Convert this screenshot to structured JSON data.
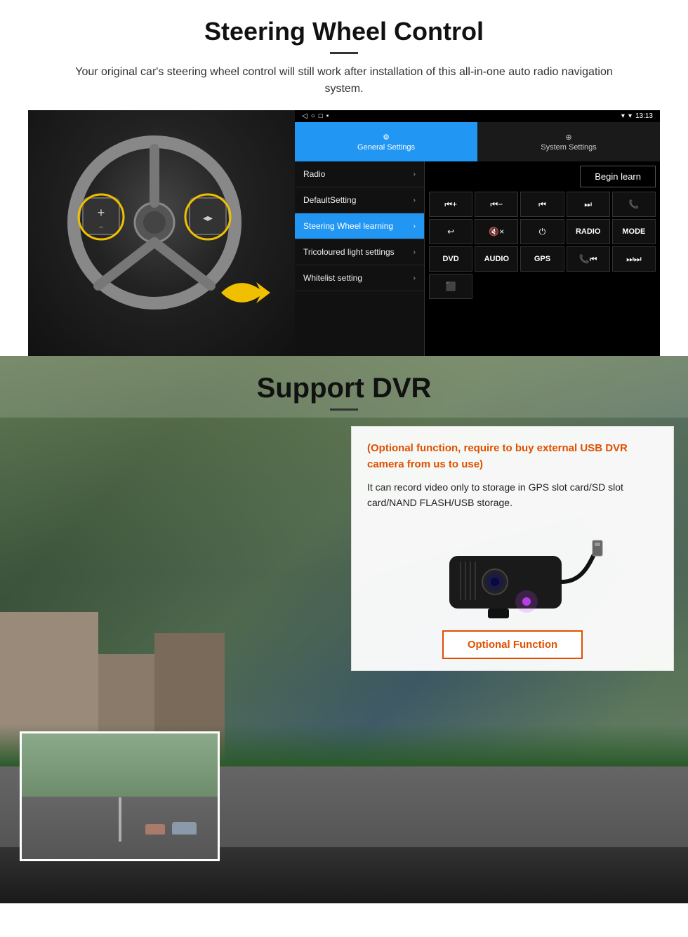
{
  "steering_section": {
    "title": "Steering Wheel Control",
    "subtitle": "Your original car's steering wheel control will still work after installation of this all-in-one auto radio navigation system.",
    "android_ui": {
      "status_bar": {
        "time": "13:13",
        "icons": "▸ ○ □ ▪ ▾ ▾"
      },
      "tab_general": "General Settings",
      "tab_system": "System Settings",
      "menu_items": [
        {
          "label": "Radio",
          "active": false
        },
        {
          "label": "DefaultSetting",
          "active": false
        },
        {
          "label": "Steering Wheel learning",
          "active": true
        },
        {
          "label": "Tricoloured light settings",
          "active": false
        },
        {
          "label": "Whitelist setting",
          "active": false
        }
      ],
      "begin_learn": "Begin learn",
      "control_buttons": [
        "⏮+",
        "⏮-",
        "⏭",
        "⏭⏭",
        "📞",
        "↩",
        "🔇x",
        "⏻",
        "RADIO",
        "MODE",
        "DVD",
        "AUDIO",
        "GPS",
        "📞⏭",
        "⏭⏭"
      ]
    }
  },
  "dvr_section": {
    "title": "Support DVR",
    "optional_text": "(Optional function, require to buy external USB DVR camera from us to use)",
    "description": "It can record video only to storage in GPS slot card/SD slot card/NAND FLASH/USB storage.",
    "optional_function_btn": "Optional Function"
  }
}
